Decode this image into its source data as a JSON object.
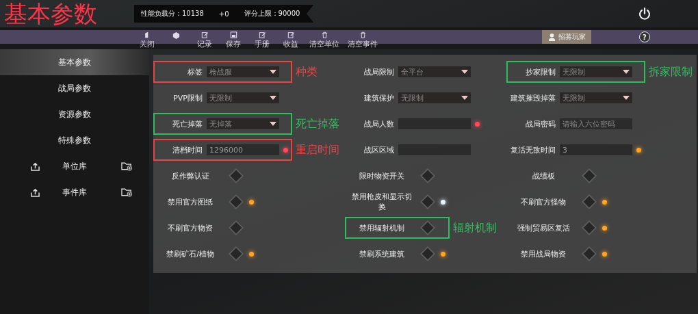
{
  "title_annotation": {
    "text": "基本参数",
    "color": "#ff3347"
  },
  "stats": {
    "load": "性能负载分：10138",
    "delta": "+0",
    "limit": "评分上限：90000"
  },
  "toolbar": [
    {
      "kind": "door",
      "label": "关闭"
    },
    {
      "kind": "box"
    },
    {
      "kind": "edit",
      "label": "记录"
    },
    {
      "kind": "save",
      "label": "保存"
    },
    {
      "kind": "edit",
      "label": "手册"
    },
    {
      "kind": "edit",
      "label": "收益"
    },
    {
      "kind": "trash",
      "label": "清空单位"
    },
    {
      "kind": "trash",
      "label": "清空事件"
    }
  ],
  "recruit_button": "招募玩家",
  "help_button": "?",
  "sidebar": [
    {
      "label": "基本参数",
      "selected": true
    },
    {
      "label": "战局参数",
      "selected": false
    },
    {
      "label": "资源参数",
      "selected": false
    },
    {
      "label": "特殊参数",
      "selected": false
    },
    {
      "label": "单位库",
      "selected": false,
      "icons": true
    },
    {
      "label": "事件库",
      "selected": false,
      "icons": true
    }
  ],
  "settings": [
    {
      "kind": "dropdown",
      "label": "标签",
      "value": "枪战服",
      "annotation": {
        "text": "种类",
        "color": "#e84545"
      }
    },
    {
      "kind": "dropdown",
      "label": "战局限制",
      "value": "全平台"
    },
    {
      "kind": "dropdown",
      "label": "抄家限制",
      "value": "无限制",
      "annotation": {
        "text": "拆家限制",
        "color": "#2fbf5a"
      }
    },
    {
      "kind": "dropdown",
      "label": "PVP限制",
      "value": "无限制"
    },
    {
      "kind": "dropdown",
      "label": "建筑保护",
      "value": "无限制"
    },
    {
      "kind": "dropdown",
      "label": "建筑摧毁掉落",
      "value": "无限制"
    },
    {
      "kind": "dropdown",
      "label": "死亡掉落",
      "value": "无掉落",
      "annotation": {
        "text": "死亡掉落",
        "color": "#2fbf5a"
      }
    },
    {
      "kind": "input",
      "label": "战局人数",
      "color": "#ff4a5a"
    },
    {
      "kind": "input",
      "label": "战局密码",
      "placeholder": "请输入六位密码"
    },
    {
      "kind": "input",
      "label": "清档时间",
      "value": "1296000",
      "color": "#ff4a5a",
      "annotation": {
        "text": "重启时间",
        "color": "#e84545"
      }
    },
    {
      "kind": "input",
      "label": "战区区域"
    },
    {
      "kind": "input",
      "label": "复活无敌时间",
      "value": "3",
      "color": "#ffa526"
    },
    {
      "kind": "toggle",
      "label": "反作弊认证",
      "on": false
    },
    {
      "kind": "toggle",
      "label": "限时物资开关",
      "on": false
    },
    {
      "kind": "toggle",
      "label": "战绩板",
      "on": false
    },
    {
      "kind": "toggle",
      "label": "禁用官方图纸",
      "on": false,
      "color": "#ffa526"
    },
    {
      "kind": "toggle",
      "label": "禁用枪皮和显示切换",
      "on": false,
      "color": "#e8f4ff"
    },
    {
      "kind": "toggle",
      "label": "不刷官方怪物",
      "on": false,
      "color": "#ffa526"
    },
    {
      "kind": "toggle",
      "label": "不刷官方物资",
      "on": false
    },
    {
      "kind": "toggle",
      "label": "禁用辐射机制",
      "on": false,
      "annotation": {
        "text": "辐射机制",
        "color": "#2fbf5a"
      }
    },
    {
      "kind": "toggle",
      "label": "强制贸易区复活",
      "on": false,
      "color": "#ffa526"
    },
    {
      "kind": "toggle",
      "label": "禁刷矿石/植物",
      "on": false,
      "color": "#ffa526"
    },
    {
      "kind": "toggle",
      "label": "禁刷系统建筑",
      "on": false,
      "color": "#ffa526"
    },
    {
      "kind": "toggle",
      "label": "禁用战局物资",
      "on": false,
      "color": "#ffa526"
    }
  ]
}
